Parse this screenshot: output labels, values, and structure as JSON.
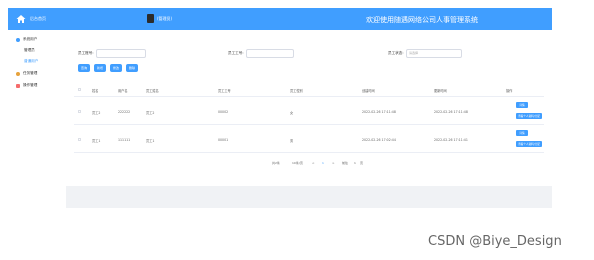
{
  "header": {
    "logo_text": "后台首页",
    "user_name": "(管理员)",
    "title": "欢迎使用随遇网络公司人事管理系统",
    "brand_color": "#409eff"
  },
  "sidebar": {
    "items": [
      {
        "label": "系统用户",
        "icon": "user-icon",
        "color": "#409eff"
      },
      {
        "label": "管理员",
        "icon": "",
        "color": ""
      },
      {
        "label": "普通用户",
        "icon": "",
        "color": "#409eff"
      },
      {
        "label": "任务管理",
        "icon": "task-icon",
        "color": "#e6a23c"
      },
      {
        "label": "操作管理",
        "icon": "grid-icon",
        "color": "#f56c6c"
      }
    ]
  },
  "search": {
    "employee_no_label": "员工账号:",
    "employee_name_label": "员工工号:",
    "status_label": "员工状态:",
    "status_placeholder": "请选择"
  },
  "actions": {
    "search": "查询",
    "add": "新增",
    "edit": "修改",
    "delete": "删除"
  },
  "table": {
    "headers": [
      "姓名",
      "用户名",
      "员工姓名",
      "员工工号",
      "员工性别",
      "创建时间",
      "更新时间",
      "操作"
    ],
    "rows": [
      {
        "name": "员工2",
        "username": "222222",
        "real_name": "员工2",
        "emp_no": "00002",
        "gender": "女",
        "created": "2022-02-26 17:11:48",
        "updated": "2022-02-26 17:11:48"
      },
      {
        "name": "员工1",
        "username": "111111",
        "real_name": "员工1",
        "emp_no": "00001",
        "gender": "男",
        "created": "2022-02-26 17:02:44",
        "updated": "2022-02-26 17:11:41"
      }
    ],
    "row_edit": "详情",
    "row_more": "查看个人资料/分配"
  },
  "pager": {
    "total": "共2条",
    "per_page": "10条/页",
    "prev": "<",
    "current": "1",
    "next": ">",
    "goto": "前往",
    "page_input": "1",
    "page_suffix": "页"
  },
  "watermark": "CSDN @Biye_Design"
}
